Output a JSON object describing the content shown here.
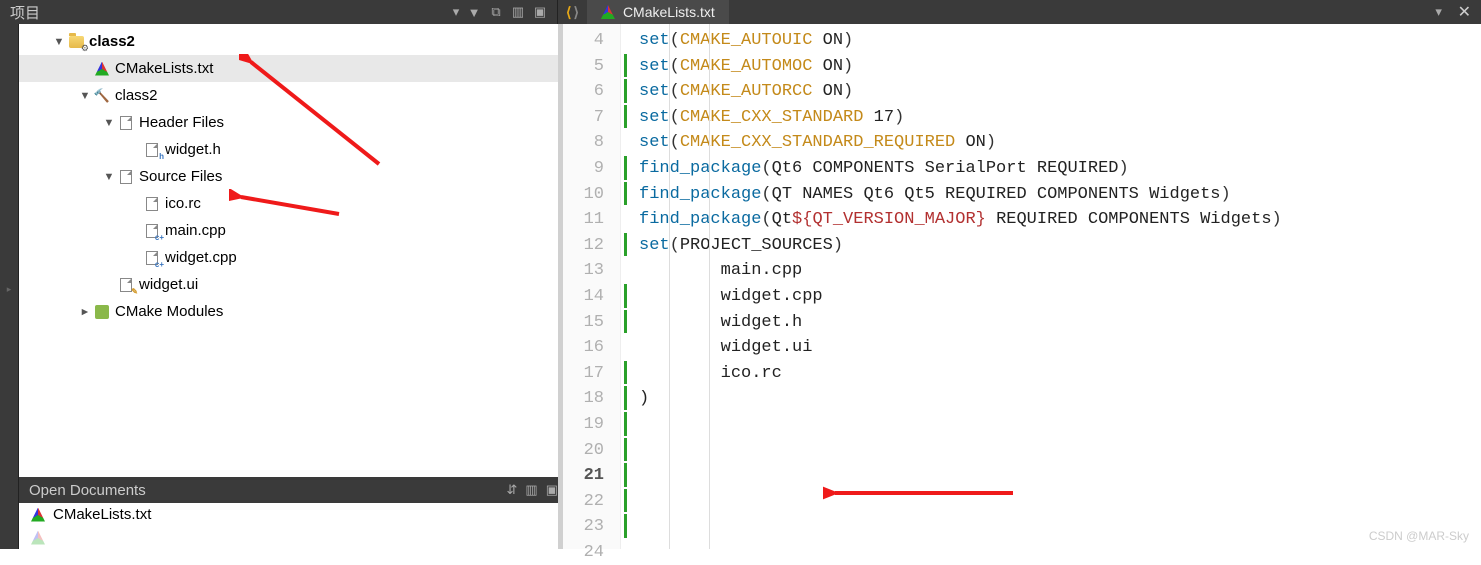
{
  "topbar": {
    "left_title": "项目",
    "tab_label": "CMakeLists.txt"
  },
  "tree": {
    "n0": "class2",
    "n1": "CMakeLists.txt",
    "n2": "class2",
    "n3": "Header Files",
    "n4": "widget.h",
    "n5": "Source Files",
    "n6": "ico.rc",
    "n7": "main.cpp",
    "n8": "widget.cpp",
    "n9": "widget.ui",
    "n10": "CMake Modules"
  },
  "open_docs": {
    "header": "Open Documents",
    "items": [
      "CMakeLists.txt"
    ]
  },
  "editor": {
    "line_start": 4,
    "line_end": 24,
    "current_line": 21,
    "marks": [
      5,
      6,
      7,
      9,
      10,
      12,
      14,
      15,
      17,
      18,
      19,
      20,
      21,
      22,
      23
    ]
  },
  "code": {
    "l4": "",
    "l5": {
      "fn": "set",
      "a": "CMAKE_AUTOUIC",
      "b": " ON"
    },
    "l6": {
      "fn": "set",
      "a": "CMAKE_AUTOMOC",
      "b": " ON"
    },
    "l7": {
      "fn": "set",
      "a": "CMAKE_AUTORCC",
      "b": " ON"
    },
    "l8": "",
    "l9": {
      "fn": "set",
      "a": "CMAKE_CXX_STANDARD",
      "b": " 17"
    },
    "l10": {
      "fn": "set",
      "a": "CMAKE_CXX_STANDARD_REQUIRED",
      "b": " ON"
    },
    "l11": "",
    "l12": {
      "fn": "find_package",
      "body": "Qt6 COMPONENTS SerialPort REQUIRED"
    },
    "l13": "",
    "l14": {
      "fn": "find_package",
      "body": "QT NAMES Qt6 Qt5 REQUIRED COMPONENTS Widgets"
    },
    "l15": {
      "fn": "find_package",
      "pre": "Qt",
      "var": "${",
      "vbody": "QT_VERSION_MAJOR",
      "vend": "}",
      "post": " REQUIRED COMPONENTS Widgets"
    },
    "l16": "",
    "l17": {
      "fn": "set",
      "body": "PROJECT_SOURCES"
    },
    "l18": "        main.cpp",
    "l19": "        widget.cpp",
    "l20": "        widget.h",
    "l21": "        widget.ui",
    "l22": "        ico.rc",
    "l23": ")"
  },
  "watermark": "CSDN @MAR-Sky"
}
